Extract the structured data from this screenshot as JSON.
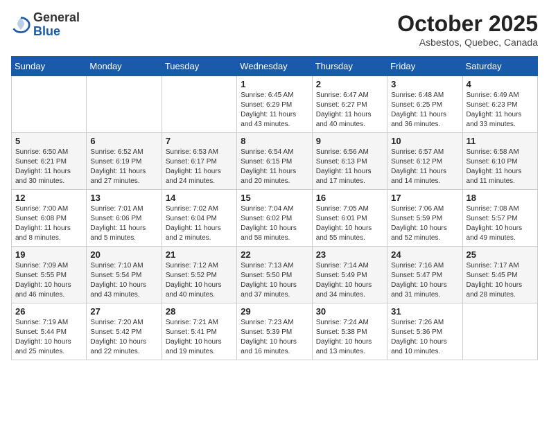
{
  "header": {
    "logo_general": "General",
    "logo_blue": "Blue",
    "month_title": "October 2025",
    "location": "Asbestos, Quebec, Canada"
  },
  "weekdays": [
    "Sunday",
    "Monday",
    "Tuesday",
    "Wednesday",
    "Thursday",
    "Friday",
    "Saturday"
  ],
  "weeks": [
    [
      {
        "day": "",
        "info": ""
      },
      {
        "day": "",
        "info": ""
      },
      {
        "day": "",
        "info": ""
      },
      {
        "day": "1",
        "info": "Sunrise: 6:45 AM\nSunset: 6:29 PM\nDaylight: 11 hours\nand 43 minutes."
      },
      {
        "day": "2",
        "info": "Sunrise: 6:47 AM\nSunset: 6:27 PM\nDaylight: 11 hours\nand 40 minutes."
      },
      {
        "day": "3",
        "info": "Sunrise: 6:48 AM\nSunset: 6:25 PM\nDaylight: 11 hours\nand 36 minutes."
      },
      {
        "day": "4",
        "info": "Sunrise: 6:49 AM\nSunset: 6:23 PM\nDaylight: 11 hours\nand 33 minutes."
      }
    ],
    [
      {
        "day": "5",
        "info": "Sunrise: 6:50 AM\nSunset: 6:21 PM\nDaylight: 11 hours\nand 30 minutes."
      },
      {
        "day": "6",
        "info": "Sunrise: 6:52 AM\nSunset: 6:19 PM\nDaylight: 11 hours\nand 27 minutes."
      },
      {
        "day": "7",
        "info": "Sunrise: 6:53 AM\nSunset: 6:17 PM\nDaylight: 11 hours\nand 24 minutes."
      },
      {
        "day": "8",
        "info": "Sunrise: 6:54 AM\nSunset: 6:15 PM\nDaylight: 11 hours\nand 20 minutes."
      },
      {
        "day": "9",
        "info": "Sunrise: 6:56 AM\nSunset: 6:13 PM\nDaylight: 11 hours\nand 17 minutes."
      },
      {
        "day": "10",
        "info": "Sunrise: 6:57 AM\nSunset: 6:12 PM\nDaylight: 11 hours\nand 14 minutes."
      },
      {
        "day": "11",
        "info": "Sunrise: 6:58 AM\nSunset: 6:10 PM\nDaylight: 11 hours\nand 11 minutes."
      }
    ],
    [
      {
        "day": "12",
        "info": "Sunrise: 7:00 AM\nSunset: 6:08 PM\nDaylight: 11 hours\nand 8 minutes."
      },
      {
        "day": "13",
        "info": "Sunrise: 7:01 AM\nSunset: 6:06 PM\nDaylight: 11 hours\nand 5 minutes."
      },
      {
        "day": "14",
        "info": "Sunrise: 7:02 AM\nSunset: 6:04 PM\nDaylight: 11 hours\nand 2 minutes."
      },
      {
        "day": "15",
        "info": "Sunrise: 7:04 AM\nSunset: 6:02 PM\nDaylight: 10 hours\nand 58 minutes."
      },
      {
        "day": "16",
        "info": "Sunrise: 7:05 AM\nSunset: 6:01 PM\nDaylight: 10 hours\nand 55 minutes."
      },
      {
        "day": "17",
        "info": "Sunrise: 7:06 AM\nSunset: 5:59 PM\nDaylight: 10 hours\nand 52 minutes."
      },
      {
        "day": "18",
        "info": "Sunrise: 7:08 AM\nSunset: 5:57 PM\nDaylight: 10 hours\nand 49 minutes."
      }
    ],
    [
      {
        "day": "19",
        "info": "Sunrise: 7:09 AM\nSunset: 5:55 PM\nDaylight: 10 hours\nand 46 minutes."
      },
      {
        "day": "20",
        "info": "Sunrise: 7:10 AM\nSunset: 5:54 PM\nDaylight: 10 hours\nand 43 minutes."
      },
      {
        "day": "21",
        "info": "Sunrise: 7:12 AM\nSunset: 5:52 PM\nDaylight: 10 hours\nand 40 minutes."
      },
      {
        "day": "22",
        "info": "Sunrise: 7:13 AM\nSunset: 5:50 PM\nDaylight: 10 hours\nand 37 minutes."
      },
      {
        "day": "23",
        "info": "Sunrise: 7:14 AM\nSunset: 5:49 PM\nDaylight: 10 hours\nand 34 minutes."
      },
      {
        "day": "24",
        "info": "Sunrise: 7:16 AM\nSunset: 5:47 PM\nDaylight: 10 hours\nand 31 minutes."
      },
      {
        "day": "25",
        "info": "Sunrise: 7:17 AM\nSunset: 5:45 PM\nDaylight: 10 hours\nand 28 minutes."
      }
    ],
    [
      {
        "day": "26",
        "info": "Sunrise: 7:19 AM\nSunset: 5:44 PM\nDaylight: 10 hours\nand 25 minutes."
      },
      {
        "day": "27",
        "info": "Sunrise: 7:20 AM\nSunset: 5:42 PM\nDaylight: 10 hours\nand 22 minutes."
      },
      {
        "day": "28",
        "info": "Sunrise: 7:21 AM\nSunset: 5:41 PM\nDaylight: 10 hours\nand 19 minutes."
      },
      {
        "day": "29",
        "info": "Sunrise: 7:23 AM\nSunset: 5:39 PM\nDaylight: 10 hours\nand 16 minutes."
      },
      {
        "day": "30",
        "info": "Sunrise: 7:24 AM\nSunset: 5:38 PM\nDaylight: 10 hours\nand 13 minutes."
      },
      {
        "day": "31",
        "info": "Sunrise: 7:26 AM\nSunset: 5:36 PM\nDaylight: 10 hours\nand 10 minutes."
      },
      {
        "day": "",
        "info": ""
      }
    ]
  ]
}
